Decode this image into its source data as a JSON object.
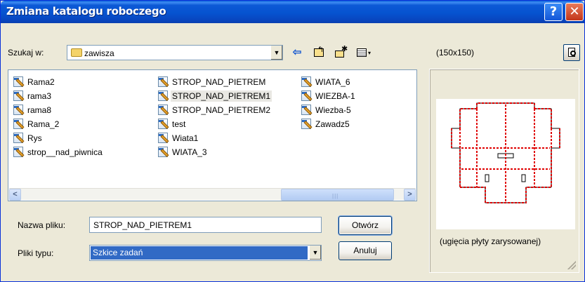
{
  "window": {
    "title": "Zmiana katalogu roboczego",
    "help_glyph": "?",
    "close_glyph": "✕"
  },
  "toolbar": {
    "lookin_label": "Szukaj w:",
    "lookin_value": "zawisza",
    "dropdown_glyph": "▼",
    "back_glyph": "⇦",
    "up_glyph": "↰",
    "new_folder_glyph": "✱",
    "view_caret": "▾"
  },
  "files": [
    {
      "name": "Rama2"
    },
    {
      "name": "rama3"
    },
    {
      "name": "rama8"
    },
    {
      "name": "Rama_2"
    },
    {
      "name": "Rys"
    },
    {
      "name": "strop__nad_piwnica"
    },
    {
      "name": "STROP_NAD_PIETREM"
    },
    {
      "name": "STROP_NAD_PIETREM1",
      "selected": true
    },
    {
      "name": "STROP_NAD_PIETREM2"
    },
    {
      "name": "test"
    },
    {
      "name": "Wiata1"
    },
    {
      "name": "WIATA_3"
    },
    {
      "name": "WIATA_6"
    },
    {
      "name": "WIEZBA-1"
    },
    {
      "name": "Wiezba-5"
    },
    {
      "name": "Zawadz5"
    }
  ],
  "scrollbar": {
    "left_glyph": "<",
    "right_glyph": ">",
    "grip": "|||"
  },
  "form": {
    "filename_label": "Nazwa pliku:",
    "filename_value": "STROP_NAD_PIETREM1",
    "filetype_label": "Pliki typu:",
    "filetype_value": "Szkice zadań",
    "open_button": "Otwórz",
    "cancel_button": "Anuluj"
  },
  "preview": {
    "dimensions": "(150x150)",
    "caption": "(ugięcia płyty zarysowanej)"
  }
}
